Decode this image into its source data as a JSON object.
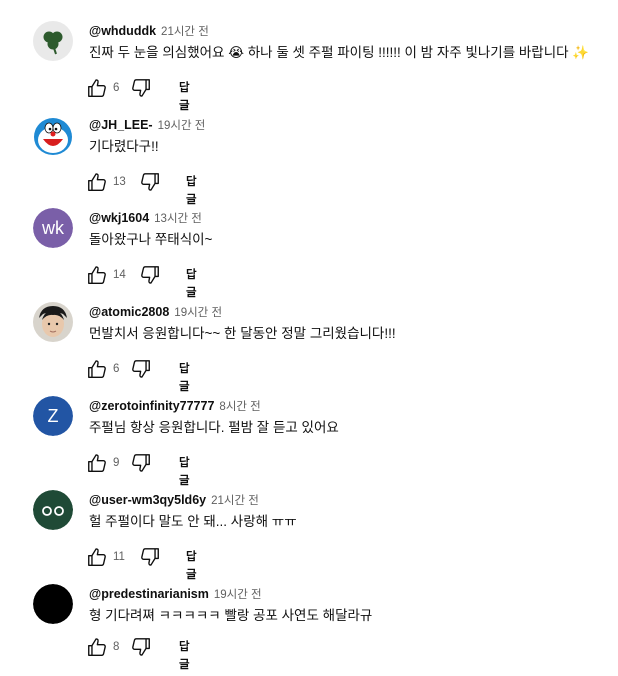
{
  "comments": [
    {
      "handle": "@whduddk",
      "time": "21시간 전",
      "text": "진짜 두 눈을 의심했어요 😭 하나 둘 셋 주펄 파이팅 !!!!!! 이 밤 자주 빛나기를 바랍니다 ✨",
      "likes": "6",
      "reply": "답글",
      "avatar_icon": "clover-icon"
    },
    {
      "handle": "@JH_LEE-",
      "time": "19시간 전",
      "text": "기다렸다구!!",
      "likes": "13",
      "reply": "답글",
      "avatar_icon": "doraemon-icon"
    },
    {
      "handle": "@wkj1604",
      "time": "13시간 전",
      "text": "돌아왔구나 쭈태식이~",
      "likes": "14",
      "reply": "답글",
      "avatar_letters": "wk"
    },
    {
      "handle": "@atomic2808",
      "time": "19시간 전",
      "text": "먼발치서 응원합니다~~  한 달동안 정말 그리웠습니다!!!",
      "likes": "6",
      "reply": "답글",
      "avatar_icon": "person-photo-icon"
    },
    {
      "handle": "@zerotoinfinity77777",
      "time": "8시간 전",
      "text": "주펄님 항상 응원합니다. 펄밤 잘 듣고 있어요",
      "likes": "9",
      "reply": "답글",
      "avatar_letters": "Z"
    },
    {
      "handle": "@user-wm3qy5ld6y",
      "time": "21시간 전",
      "text": "헐 주펄이다 말도 안 돼... 사랑해 ㅠㅠ",
      "likes": "11",
      "reply": "답글",
      "avatar_icon": "eyes-icon"
    },
    {
      "handle": "@predestinarianism",
      "time": "19시간 전",
      "text": "형 기다려쪄 ㅋㅋㅋㅋㅋ 빨랑 공포 사연도 해달라규",
      "likes": "8",
      "reply": "답글",
      "avatar_icon": "black-circle-icon"
    }
  ],
  "colors": {
    "text_primary": "#0f0f0f",
    "text_secondary": "#606060",
    "avatar_wk": "#7a5fa8",
    "avatar_z": "#2255a4",
    "avatar_eyes": "#1f4a36"
  }
}
